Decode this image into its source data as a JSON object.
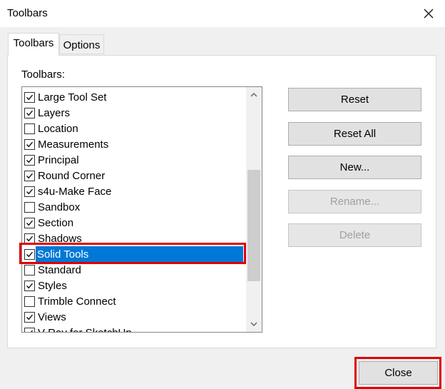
{
  "window": {
    "title": "Toolbars"
  },
  "tabs": [
    {
      "label": "Toolbars",
      "active": true
    },
    {
      "label": "Options",
      "active": false
    }
  ],
  "toolbar_list": {
    "label": "Toolbars:",
    "items": [
      {
        "label": "Large Tool Set",
        "checked": true
      },
      {
        "label": "Layers",
        "checked": true
      },
      {
        "label": "Location",
        "checked": false
      },
      {
        "label": "Measurements",
        "checked": true
      },
      {
        "label": "Principal",
        "checked": true
      },
      {
        "label": "Round Corner",
        "checked": true
      },
      {
        "label": "s4u-Make Face",
        "checked": true
      },
      {
        "label": "Sandbox",
        "checked": false
      },
      {
        "label": "Section",
        "checked": true
      },
      {
        "label": "Shadows",
        "checked": true
      },
      {
        "label": "Solid Tools",
        "checked": true,
        "selected": true
      },
      {
        "label": "Standard",
        "checked": false
      },
      {
        "label": "Styles",
        "checked": true
      },
      {
        "label": "Trimble Connect",
        "checked": false
      },
      {
        "label": "Views",
        "checked": true
      },
      {
        "label": "V-Ray for SketchUp",
        "checked": true
      }
    ]
  },
  "buttons": {
    "reset": "Reset",
    "reset_all": "Reset All",
    "new": "New...",
    "rename": "Rename...",
    "delete": "Delete",
    "close": "Close"
  },
  "colors": {
    "selection": "#0078d7",
    "highlight_box": "#e00000"
  }
}
